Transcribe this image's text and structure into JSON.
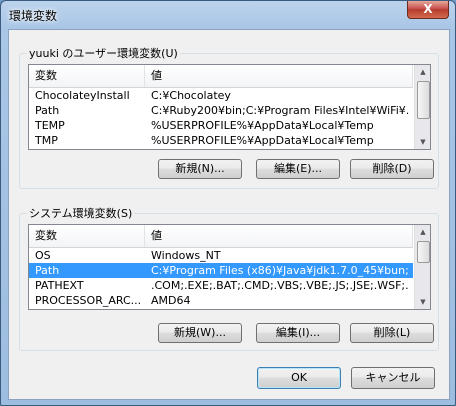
{
  "window": {
    "title": "環境変数",
    "close_glyph": "X"
  },
  "user_vars": {
    "group_label": "yuuki のユーザー環境変数(U)",
    "columns": {
      "name": "変数",
      "value": "値"
    },
    "rows": [
      {
        "name": "ChocolateyInstall",
        "value": "C:¥Chocolatey"
      },
      {
        "name": "Path",
        "value": "C:¥Ruby200¥bin;C:¥Program Files¥Intel¥WiFi¥..."
      },
      {
        "name": "TEMP",
        "value": "%USERPROFILE%¥AppData¥Local¥Temp"
      },
      {
        "name": "TMP",
        "value": "%USERPROFILE%¥AppData¥Local¥Temp"
      }
    ],
    "buttons": {
      "new": "新規(N)...",
      "edit": "編集(E)...",
      "delete": "削除(D)"
    }
  },
  "system_vars": {
    "group_label": "システム環境変数(S)",
    "columns": {
      "name": "変数",
      "value": "値"
    },
    "rows": [
      {
        "name": "OS",
        "value": "Windows_NT"
      },
      {
        "name": "Path",
        "value": "C:¥Program Files (x86)¥Java¥jdk1.7.0_45¥bun;...",
        "selected": true
      },
      {
        "name": "PATHEXT",
        "value": ".COM;.EXE;.BAT;.CMD;.VBS;.VBE;.JS;.JSE;.WSF;..."
      },
      {
        "name": "PROCESSOR_ARC...",
        "value": "AMD64"
      }
    ],
    "buttons": {
      "new": "新規(W)...",
      "edit": "編集(I)...",
      "delete": "削除(L)"
    }
  },
  "footer": {
    "ok": "OK",
    "cancel": "キャンセル"
  },
  "colors": {
    "selection": "#3399ff",
    "window_frame": "#a9c6e6"
  },
  "icons": {
    "close": "close-icon",
    "scroll_up": "chevron-up-icon",
    "scroll_down": "chevron-down-icon"
  }
}
